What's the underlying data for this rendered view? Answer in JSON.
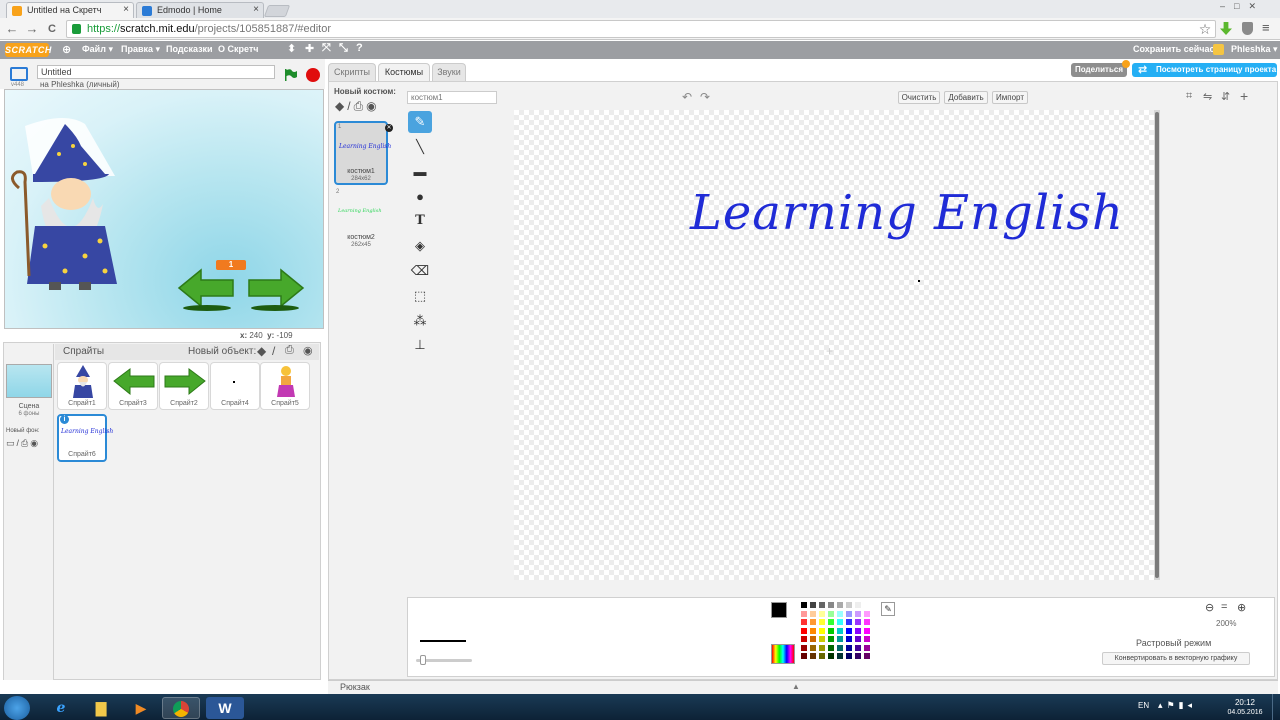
{
  "browser": {
    "tabs": [
      {
        "title": "Untitled на Скретч",
        "close": "×",
        "color": "#f8a21a"
      },
      {
        "title": "Edmodo | Home",
        "close": "×",
        "color": "#2b7bd6"
      }
    ],
    "url_scheme": "https://",
    "url_host": "scratch.mit.edu",
    "url_path": "/projects/105851887/#editor",
    "back": "←",
    "forward": "→",
    "reload": "C",
    "star": "☆"
  },
  "menubar": {
    "logo": "SCRATCH",
    "items": [
      "Файл ▾",
      "Правка ▾",
      "Подсказки",
      "О Скретч"
    ],
    "save_now": "Сохранить сейчас",
    "user": "Phleshka ▾"
  },
  "project": {
    "title": "Untitled",
    "owner": "на Phleshka (личный)",
    "version": "v448",
    "share": "Поделиться",
    "see_project": "Посмотреть страницу проекта"
  },
  "stage": {
    "coords_x_label": "x:",
    "coords_x": "240",
    "coords_y_label": "y:",
    "coords_y": "-109",
    "counter": "1"
  },
  "sprites": {
    "header": "Спрайты",
    "new_object": "Новый объект:",
    "scene_label": "Сцена",
    "scene_sub": "6 фоны",
    "new_backdrop": "Новый фон:",
    "items": [
      {
        "name": "Спрайт1"
      },
      {
        "name": "Спрайт3"
      },
      {
        "name": "Спрайт2"
      },
      {
        "name": "Спрайт4"
      },
      {
        "name": "Спрайт5"
      },
      {
        "name": "Спрайт6"
      }
    ],
    "selected_info": "i"
  },
  "editor": {
    "tabs": [
      "Скрипты",
      "Костюмы",
      "Звуки"
    ],
    "new_costume": "Новый костюм:",
    "costume_name_placeholder": "костюм1",
    "costumes": [
      {
        "index": "1",
        "name": "костюм1",
        "size": "284x62",
        "preview": "Learning English"
      },
      {
        "index": "2",
        "name": "костюм2",
        "size": "262x45",
        "preview": "Learning English"
      }
    ],
    "clear": "Очистить",
    "add": "Добавить",
    "import": "Импорт",
    "canvas_text": "Learning English",
    "zoom": "200%",
    "mode": "Растровый режим",
    "convert": "Конвертировать в векторную графику",
    "backpack": "Рюкзак"
  },
  "taskbar": {
    "lang": "EN",
    "time": "20:12",
    "date": "04.05.2016"
  },
  "colors": {
    "accent": "#4aa3df",
    "menubar": "#9c9ea2",
    "share_button": "#8e8e8e",
    "see_project_button": "#25aff4",
    "canvas_text": "#1f2bd6",
    "green_flag": "#1e8c2b",
    "stop": "#e00d0d"
  }
}
